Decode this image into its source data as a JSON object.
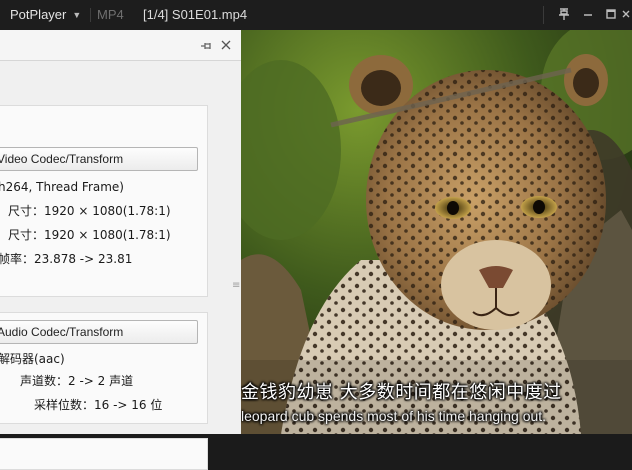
{
  "titlebar": {
    "app_name": "PotPlayer",
    "app_menu_icon": "chevron-down-icon",
    "format": "MP4",
    "title": "[1/4] S01E01.mp4",
    "buttons": [
      "pin-icon",
      "minimize-icon",
      "maximize-icon",
      "close-icon"
    ]
  },
  "panel": {
    "header_buttons": [
      "pin-icon",
      "close-icon"
    ],
    "video_section": {
      "header": "Video Codec/Transform",
      "lines": [
        "h264, Thread Frame)",
        "尺寸：1920 × 1080(1.78:1)",
        "尺寸：1920 × 1080(1.78:1)",
        "帧率：23.878 -> 23.81"
      ]
    },
    "audio_section": {
      "header": "Audio Codec/Transform",
      "lines": [
        "解码器(aac)",
        "声道数：2 -> 2 声道",
        "采样位数：16 -> 16 位"
      ]
    }
  },
  "video": {
    "subtitle_zh": "金钱豹幼崽 大多数时间都在悠闲中度过",
    "subtitle_en": "leopard cub spends most of his time hanging out."
  }
}
